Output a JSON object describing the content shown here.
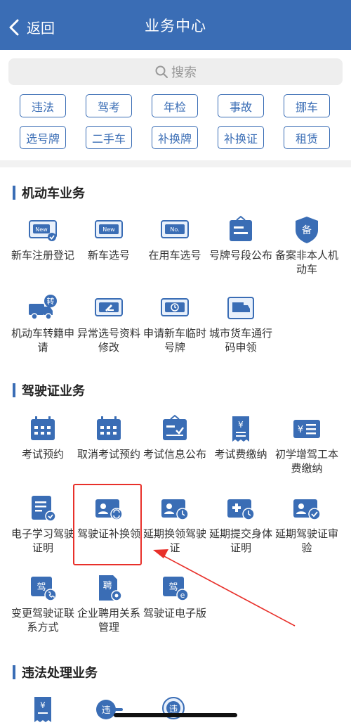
{
  "nav": {
    "back_label": "返回",
    "title": "业务中心"
  },
  "search": {
    "placeholder": "搜索"
  },
  "chips": [
    "违法",
    "驾考",
    "年检",
    "事故",
    "挪车",
    "选号牌",
    "二手车",
    "补换牌",
    "补换证",
    "租赁"
  ],
  "sections": [
    {
      "title": "机动车业务",
      "items": [
        {
          "label": "新车注册登记",
          "icon": "new-registration-icon"
        },
        {
          "label": "新车选号",
          "icon": "new-plate-select-icon"
        },
        {
          "label": "在用车选号",
          "icon": "used-car-plate-select-icon"
        },
        {
          "label": "号牌号段公布",
          "icon": "plate-segment-announce-icon"
        },
        {
          "label": "备案非本人机动车",
          "icon": "record-vehicle-shield-icon"
        },
        {
          "label": "机动车转籍申请",
          "icon": "vehicle-transfer-truck-icon"
        },
        {
          "label": "异常选号资料修改",
          "icon": "abnormal-plate-edit-icon"
        },
        {
          "label": "申请新车临时号牌",
          "icon": "temporary-plate-clock-icon"
        },
        {
          "label": "城市货车通行码申领",
          "icon": "truck-pass-code-icon"
        }
      ]
    },
    {
      "title": "驾驶证业务",
      "items": [
        {
          "label": "考试预约",
          "icon": "exam-calendar-icon"
        },
        {
          "label": "取消考试预约",
          "icon": "cancel-exam-calendar-icon"
        },
        {
          "label": "考试信息公布",
          "icon": "exam-info-board-icon"
        },
        {
          "label": "考试费缴纳",
          "icon": "exam-fee-receipt-icon"
        },
        {
          "label": "初学增驾工本费缴纳",
          "icon": "fee-payment-card-icon"
        },
        {
          "label": "电子学习驾驶证明",
          "icon": "e-study-document-icon"
        },
        {
          "label": "驾驶证补换领",
          "icon": "license-reissue-icon"
        },
        {
          "label": "延期换领驾驶证",
          "icon": "license-renew-delay-icon"
        },
        {
          "label": "延期提交身体证明",
          "icon": "health-certificate-delay-icon"
        },
        {
          "label": "延期驾驶证审验",
          "icon": "license-review-delay-icon"
        },
        {
          "label": "变更驾驶证联系方式",
          "icon": "license-contact-change-icon"
        },
        {
          "label": "企业聘用关系管理",
          "icon": "employment-management-icon"
        },
        {
          "label": "驾驶证电子版",
          "icon": "e-license-icon"
        }
      ]
    },
    {
      "title": "违法处理业务",
      "items": [
        {
          "label": "",
          "icon": "fine-payment-receipt-icon"
        },
        {
          "label": "",
          "icon": "violation-handle-icon"
        },
        {
          "label": "",
          "icon": "violation-search-icon"
        }
      ]
    }
  ],
  "annotation": {
    "highlighted_item": "驾驶证补换领",
    "color": "#e8302a"
  },
  "colors": {
    "brand": "#3a6db5",
    "icon_light": "#e8f0fb",
    "accent_red": "#e8302a"
  }
}
